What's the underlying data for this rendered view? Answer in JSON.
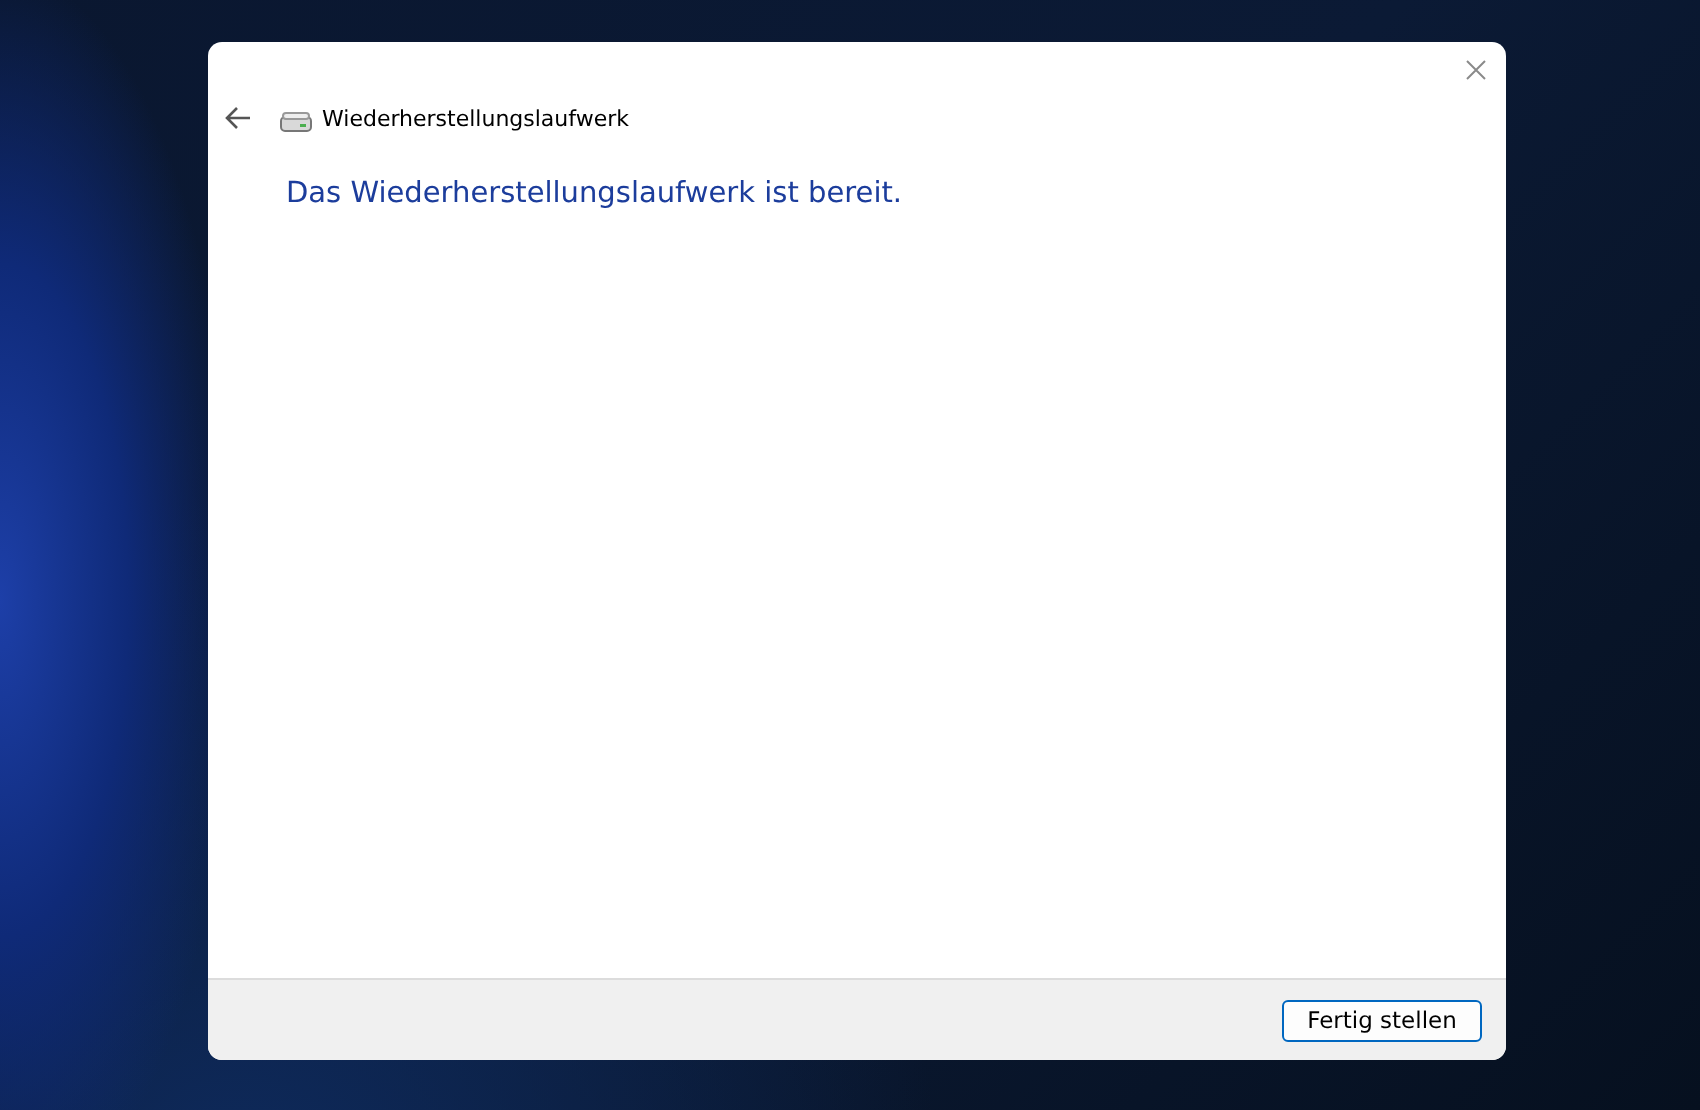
{
  "window": {
    "title": "Wiederherstellungslaufwerk"
  },
  "message": "Das Wiederherstellungslaufwerk ist bereit.",
  "buttons": [
    {
      "label": "Fertig stellen",
      "default": true
    }
  ]
}
